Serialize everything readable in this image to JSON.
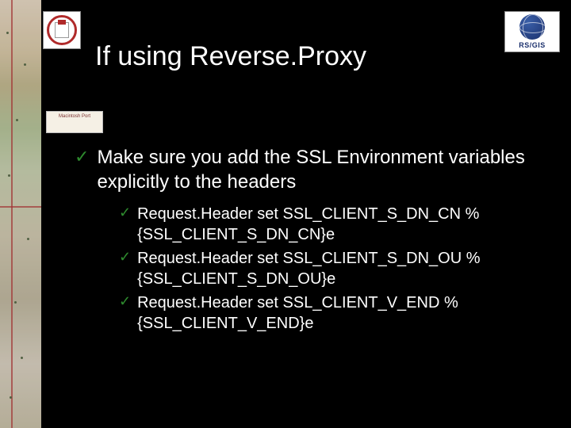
{
  "title": "If using Reverse.Proxy",
  "logos": {
    "right_text": "RS/GIS",
    "badge_text": "Macintosh Port"
  },
  "main_bullet": "Make sure you add the SSL Environment variables explicitly to the headers",
  "sub_bullets": [
    "Request.Header set SSL_CLIENT_S_DN_CN %{SSL_CLIENT_S_DN_CN}e",
    " Request.Header set SSL_CLIENT_S_DN_OU %{SSL_CLIENT_S_DN_OU}e",
    "Request.Header set SSL_CLIENT_V_END %{SSL_CLIENT_V_END}e"
  ]
}
